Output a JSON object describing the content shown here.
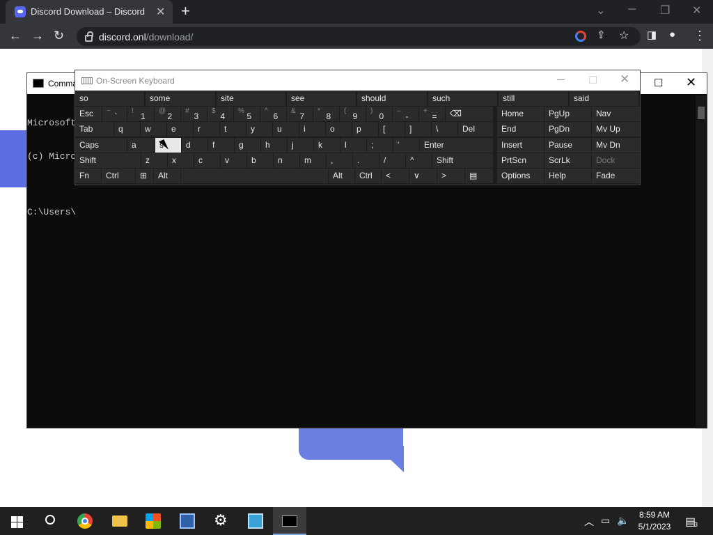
{
  "browser": {
    "tab_title": "Discord Download – Discord",
    "url_host": "discord.onl",
    "url_path": "/download/",
    "icons": [
      "back-icon",
      "forward-icon",
      "reload-icon",
      "lock-icon",
      "google-icon",
      "share-icon",
      "star-icon",
      "sidepanel-icon",
      "profile-icon",
      "menu-icon"
    ]
  },
  "cmd": {
    "title": "Comma",
    "lines": [
      "Microsoft",
      "(c) Micro",
      "",
      "C:\\Users\\"
    ]
  },
  "osk": {
    "title": "On-Screen Keyboard",
    "predictions": [
      "so",
      "some",
      "site",
      "see",
      "should",
      "such",
      "still",
      "said"
    ],
    "row1": [
      {
        "m": "Esc"
      },
      {
        "s": "~",
        "m": "`"
      },
      {
        "s": "!",
        "m": "1"
      },
      {
        "s": "@",
        "m": "2"
      },
      {
        "s": "#",
        "m": "3"
      },
      {
        "s": "$",
        "m": "4"
      },
      {
        "s": "%",
        "m": "5"
      },
      {
        "s": "^",
        "m": "6"
      },
      {
        "s": "&",
        "m": "7"
      },
      {
        "s": "*",
        "m": "8"
      },
      {
        "s": "(",
        "m": "9"
      },
      {
        "s": ")",
        "m": "0"
      },
      {
        "s": "–",
        "m": "-"
      },
      {
        "s": "+",
        "m": "="
      },
      {
        "m": "⌫"
      }
    ],
    "row2": [
      "Tab",
      "q",
      "w",
      "e",
      "r",
      "t",
      "y",
      "u",
      "i",
      "o",
      "p",
      "[",
      "]",
      "\\",
      "Del"
    ],
    "row3": [
      "Caps",
      "a",
      "s",
      "d",
      "f",
      "g",
      "h",
      "j",
      "k",
      "l",
      ";",
      "'",
      "Enter"
    ],
    "row4": [
      "Shift",
      "z",
      "x",
      "c",
      "v",
      "b",
      "n",
      "m",
      ",",
      ".",
      "/",
      "^",
      "Shift"
    ],
    "row5": [
      "Fn",
      "Ctrl",
      "⊞",
      "Alt",
      "",
      "Alt",
      "Ctrl",
      "<",
      "∨",
      ">",
      "▤"
    ],
    "side": [
      [
        "Home",
        "PgUp",
        "Nav"
      ],
      [
        "End",
        "PgDn",
        "Mv Up"
      ],
      [
        "Insert",
        "Pause",
        "Mv Dn"
      ],
      [
        "PrtScn",
        "ScrLk",
        "Dock"
      ],
      [
        "Options",
        "Help",
        "Fade"
      ]
    ]
  },
  "taskbar": {
    "time": "8:59 AM",
    "date": "5/1/2023",
    "notifications": "3",
    "apps": [
      "start-icon",
      "search-icon",
      "chrome-icon",
      "file-explorer-icon",
      "store-icon",
      "app-icon",
      "settings-icon",
      "control-panel-icon",
      "cmd-icon"
    ]
  }
}
